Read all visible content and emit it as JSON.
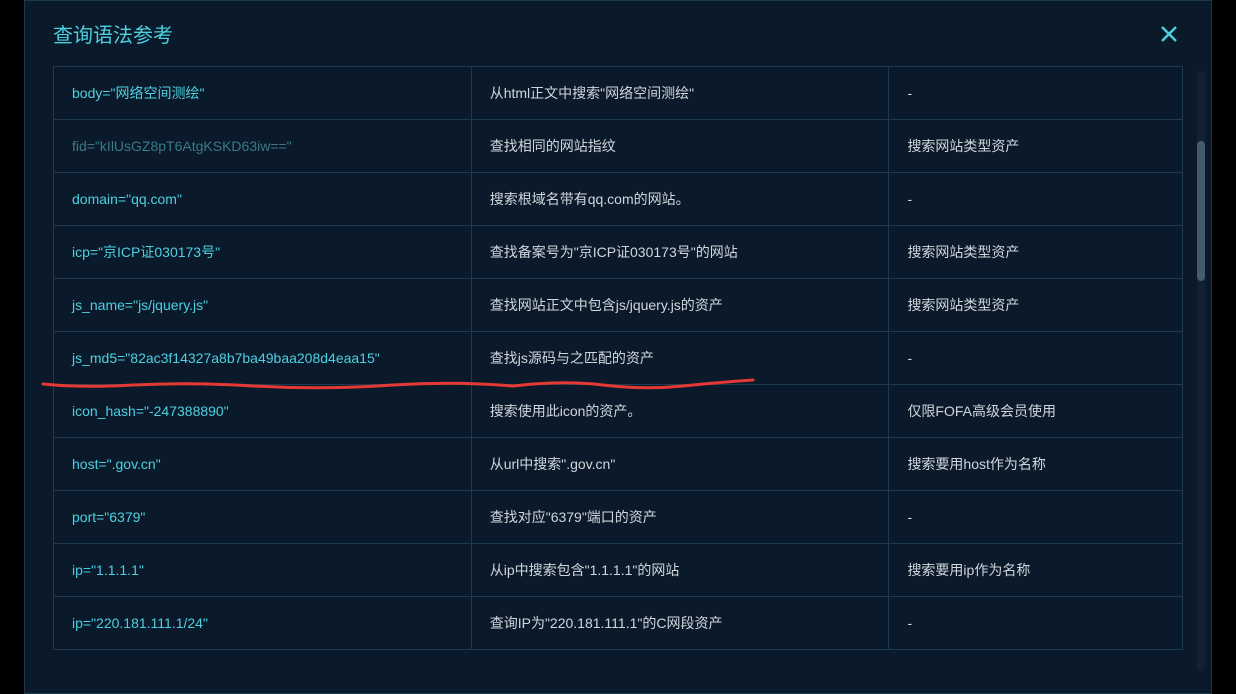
{
  "modal": {
    "title": "查询语法参考"
  },
  "rows": [
    {
      "syntax": "body=\"网络空间测绘\"",
      "desc": "从html正文中搜索\"网络空间测绘\"",
      "note": "-",
      "dim": false
    },
    {
      "syntax": "fid=\"kIlUsGZ8pT6AtgKSKD63iw==\"",
      "desc": "查找相同的网站指纹",
      "note": "搜索网站类型资产",
      "dim": true
    },
    {
      "syntax": "domain=\"qq.com\"",
      "desc": "搜索根域名带有qq.com的网站。",
      "note": "-",
      "dim": false
    },
    {
      "syntax": "icp=\"京ICP证030173号\"",
      "desc": "查找备案号为\"京ICP证030173号\"的网站",
      "note": "搜索网站类型资产",
      "dim": false
    },
    {
      "syntax": "js_name=\"js/jquery.js\"",
      "desc": "查找网站正文中包含js/jquery.js的资产",
      "note": "搜索网站类型资产",
      "dim": false
    },
    {
      "syntax": "js_md5=\"82ac3f14327a8b7ba49baa208d4eaa15\"",
      "desc": "查找js源码与之匹配的资产",
      "note": "-",
      "dim": false
    },
    {
      "syntax": "icon_hash=\"-247388890\"",
      "desc": "搜索使用此icon的资产。",
      "note": "仅限FOFA高级会员使用",
      "dim": false
    },
    {
      "syntax": "host=\".gov.cn\"",
      "desc": "从url中搜索\".gov.cn\"",
      "note": "搜索要用host作为名称",
      "dim": false
    },
    {
      "syntax": "port=\"6379\"",
      "desc": "查找对应\"6379\"端口的资产",
      "note": "-",
      "dim": false
    },
    {
      "syntax": "ip=\"1.1.1.1\"",
      "desc": "从ip中搜索包含\"1.1.1.1\"的网站",
      "note": "搜索要用ip作为名称",
      "dim": false
    },
    {
      "syntax": "ip=\"220.181.111.1/24\"",
      "desc": "查询IP为\"220.181.111.1\"的C网段资产",
      "note": "-",
      "dim": false
    }
  ]
}
